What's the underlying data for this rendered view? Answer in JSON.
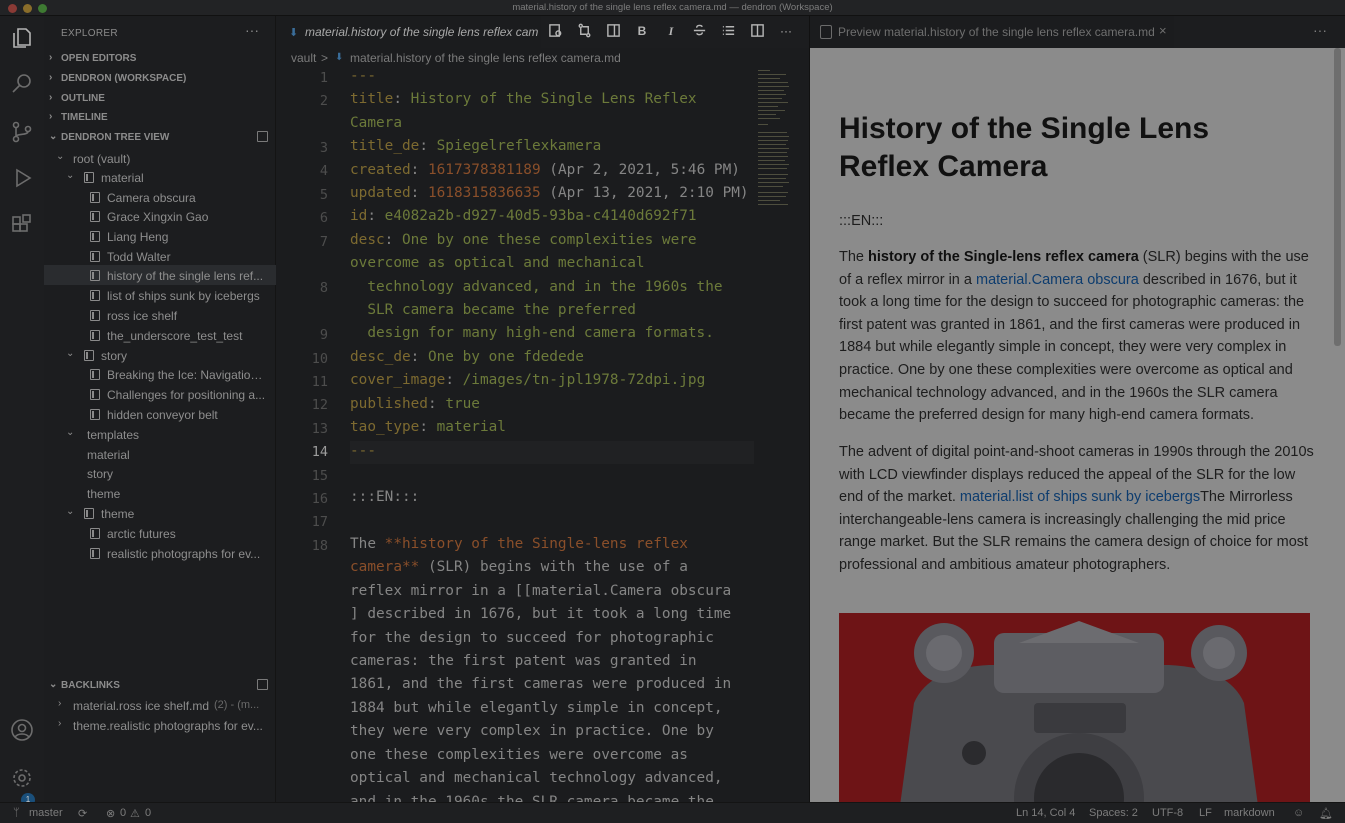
{
  "window": {
    "title": "material.history of the single lens reflex camera.md — dendron (Workspace)"
  },
  "explorer": {
    "header": "EXPLORER",
    "more": "···",
    "sections": {
      "open_editors": "OPEN EDITORS",
      "dendron_workspace": "DENDRON (WORKSPACE)",
      "outline": "OUTLINE",
      "timeline": "TIMELINE",
      "tree_view": "DENDRON TREE VIEW",
      "backlinks": "BACKLINKS"
    },
    "tree": [
      {
        "label": "root (vault)"
      },
      {
        "label": "material"
      },
      {
        "label": "Camera obscura"
      },
      {
        "label": "Grace Xingxin Gao"
      },
      {
        "label": "Liang Heng"
      },
      {
        "label": "Todd Walter"
      },
      {
        "label": "history of the single lens ref..."
      },
      {
        "label": "list of ships sunk by icebergs"
      },
      {
        "label": "ross ice shelf"
      },
      {
        "label": "the_underscore_test_test"
      },
      {
        "label": "story"
      },
      {
        "label": "Breaking the Ice: Navigation..."
      },
      {
        "label": "Challenges for positioning a..."
      },
      {
        "label": "hidden conveyor belt"
      },
      {
        "label": "templates"
      },
      {
        "label": "material"
      },
      {
        "label": "story"
      },
      {
        "label": "theme"
      },
      {
        "label": "theme"
      },
      {
        "label": "arctic futures"
      },
      {
        "label": "realistic photographs for ev..."
      }
    ],
    "backlinks": [
      {
        "label": "material.ross ice shelf.md",
        "meta": "(2) - (m..."
      },
      {
        "label": "theme.realistic photographs for ev..."
      }
    ]
  },
  "editor": {
    "tab": "material.history of the single lens reflex cam",
    "toolbar": {
      "bold": "B",
      "italic": "I",
      "more": "···"
    },
    "breadcrumb": {
      "vault": "vault",
      "sep": ">",
      "file": "material.history of the single lens reflex camera.md"
    },
    "line_numbers": [
      "1",
      "2",
      "3",
      "4",
      "5",
      "6",
      "7",
      "8",
      "9",
      "10",
      "11",
      "12",
      "13",
      "14",
      "15",
      "16",
      "17",
      "18"
    ],
    "current_line": "14",
    "lines": {
      "l1": "---",
      "l2k": "title",
      "l2v": "History of the Single Lens Reflex",
      "l2b": "Camera",
      "l3k": "title_de",
      "l3v": "Spiegelreflexkamera",
      "l4k": "created",
      "l4n": "1617378381189",
      "l4c": " (Apr 2, 2021, 5:46 PM)",
      "l5k": "updated",
      "l5n": "1618315836635",
      "l5c": " (Apr 13, 2021, 2:10 PM)",
      "l6k": "id",
      "l6v": "e4082a2b-d927-40d5-93ba-c4140d692f71",
      "l7k": "desc",
      "l7v": "One by one these complexities were",
      "l7b": "overcome as optical and mechanical",
      "l8a": "  technology advanced, and in the 1960s the",
      "l8b": "  SLR camera became the preferred",
      "l9a": "  design for many high-end camera formats.",
      "l10k": "desc_de",
      "l10v": "One by one fdedede",
      "l11k": "cover_image",
      "l11v": "/images/tn-jpl1978-72dpi.jpg",
      "l12k": "published",
      "l12v": "true",
      "l13k": "tao_type",
      "l13v": "material",
      "l14": "---",
      "l16": ":::EN:::",
      "l18a": "The ",
      "l18b": "**history of the Single-lens reflex",
      "l18c": "camera**",
      "l18d": " (SLR) begins with the use of a",
      "l18e": "reflex mirror in a [[material.Camera obscura",
      "l18f": "] described in 1676, but it took a long time",
      "l18g": "for the design to succeed for photographic",
      "l18h": "cameras: the first patent was granted in",
      "l18i": "1861, and the first cameras were produced in",
      "l18j": "1884 but while elegantly simple in concept,",
      "l18k": "they were very complex in practice. One by",
      "l18l": "one these complexities were overcome as",
      "l18m": "optical and mechanical technology advanced,",
      "l18n": "and in the 1960s the SLR camera became the"
    }
  },
  "preview": {
    "tab": "Preview material.history of the single lens reflex camera.md",
    "close": "×",
    "more": "···",
    "heading": "History of the Single Lens Reflex Camera",
    "marker": ":::EN:::",
    "p1": {
      "a": "The ",
      "bold": "history of the Single-lens reflex camera",
      "b": " (SLR) begins with the use of a reflex mirror in a ",
      "link": "material.Camera obscura",
      "c": " described in 1676, but it took a long time for the design to succeed for photographic cameras: the first patent was granted in 1861, and the first cameras were produced in 1884 but while elegantly simple in concept, they were very complex in practice. One by one these complexities were overcome as optical and mechanical technology advanced, and in the 1960s the SLR camera became the preferred design for many high-end camera formats."
    },
    "p2": {
      "a": "The advent of digital point-and-shoot cameras in 1990s through the 2010s with LCD viewfinder displays reduced the appeal of the SLR for the low end of the market. ",
      "link": "material.list of ships sunk by icebergs",
      "b": "The Mirrorless interchangeable-lens camera is increasingly challenging the mid price range market. But the SLR remains the camera design of choice for most professional and ambitious amateur photographers."
    }
  },
  "status": {
    "branch": "master",
    "errors": "0",
    "warnings": "0",
    "position": "Ln 14, Col 4",
    "spaces": "Spaces: 2",
    "encoding": "UTF-8",
    "eol": "LF",
    "language": "markdown"
  },
  "activity": {
    "badge": "1"
  }
}
